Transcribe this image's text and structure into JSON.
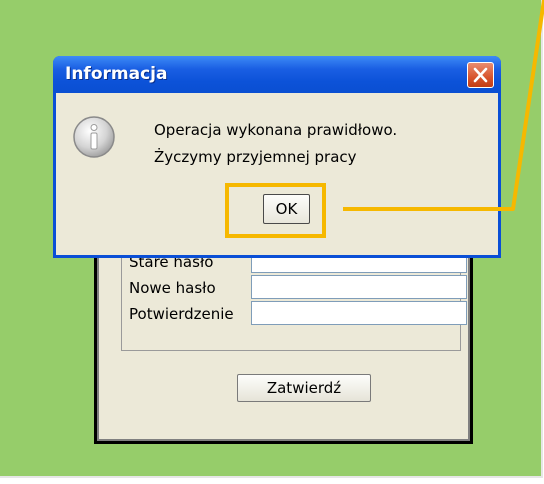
{
  "dialog": {
    "title": "Informacja",
    "message_line1": "Operacja wykonana prawidłowo.",
    "message_line2": "Życzymy przyjemnej pracy",
    "ok_label": "OK",
    "icon": "info-icon",
    "close_icon": "close-icon"
  },
  "background_window": {
    "fields": [
      {
        "label": "Stare hasło",
        "value": ""
      },
      {
        "label": "Nowe hasło",
        "value": ""
      },
      {
        "label": "Potwierdzenie",
        "value": ""
      }
    ],
    "submit_label": "Zatwierdź"
  },
  "annotation": {
    "highlight_color": "#f6b800",
    "target": "ok-button"
  },
  "colors": {
    "background": "#96cd6a",
    "titlebar": "#0a4fd6",
    "dialog_body": "#ece9d8",
    "close_button": "#d8542e"
  }
}
